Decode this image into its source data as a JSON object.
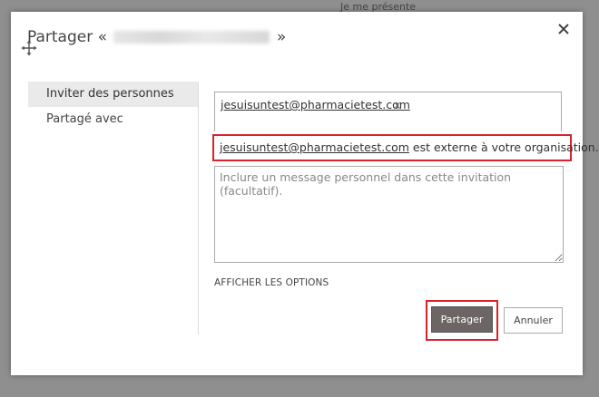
{
  "background": {
    "text": "Je me présente"
  },
  "dialog": {
    "title_prefix": "Partager «",
    "title_suffix": "»",
    "close_icon": "close-icon",
    "move_icon": "move-icon"
  },
  "sidebar": {
    "items": [
      {
        "label": "Inviter des personnes",
        "active": true
      },
      {
        "label": "Partagé avec",
        "active": false
      }
    ]
  },
  "invite": {
    "recipient": "jesuisuntest@pharmacietest.com",
    "remove_label": "x",
    "warning_email": "jesuisuntest@pharmacietest.com",
    "warning_text": " est externe à votre organisation.",
    "message_placeholder": "Inclure un message personnel dans cette invitation (facultatif).",
    "show_options": "AFFICHER LES OPTIONS"
  },
  "buttons": {
    "share": "Partager",
    "cancel": "Annuler"
  },
  "colors": {
    "highlight": "#d7232c",
    "primary_button": "#6b6664"
  }
}
